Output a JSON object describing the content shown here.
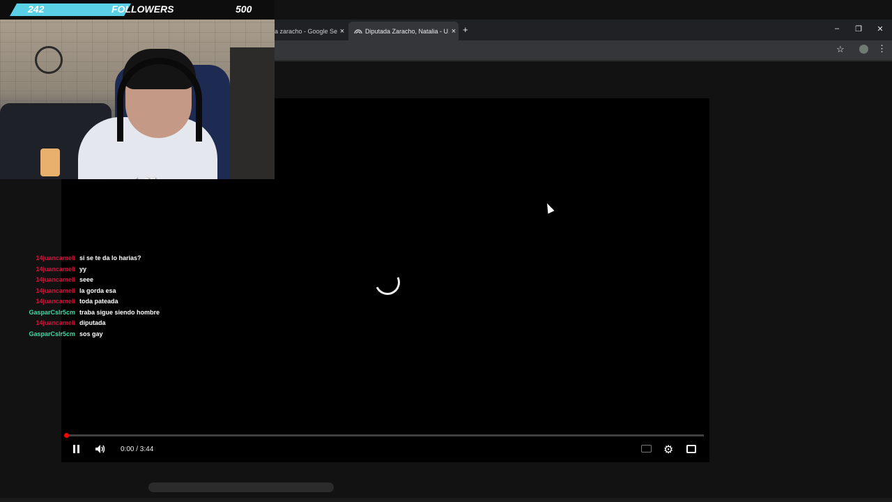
{
  "goal": {
    "current": "242",
    "label": "FOLLOWERS",
    "target": "500",
    "progress_fraction": 0.484,
    "fill_color": "#5ad0e6"
  },
  "browser": {
    "tabs": [
      {
        "title": "a zaracho - Google Sea",
        "active": false,
        "close": "×"
      },
      {
        "title": "Diputada Zaracho, Natalia - U...",
        "active": true,
        "close": "×"
      }
    ],
    "new_tab": "+",
    "window_controls": {
      "minimize": "–",
      "maximize": "❐",
      "close": "✕"
    },
    "toolbar": {
      "bookmark_icon": "star-icon",
      "menu_icon": "kebab-menu-icon"
    }
  },
  "webcam": {
    "overlay_name": "sampie05"
  },
  "player": {
    "time": "0:00 / 3:44",
    "progress_fraction": 0.0,
    "state": "loading",
    "controls": [
      "pause-icon",
      "volume-icon",
      "captions-icon",
      "gear-icon",
      "theater-icon"
    ],
    "accent_color": "#ff0000"
  },
  "chat": {
    "messages": [
      {
        "user": "14juancameli",
        "text": "si se te da lo harias?",
        "color": "#d1143b"
      },
      {
        "user": "14juancameli",
        "text": "yy",
        "color": "#d1143b"
      },
      {
        "user": "14juancameli",
        "text": "seee",
        "color": "#d1143b"
      },
      {
        "user": "14juancameli",
        "text": "la gorda esa",
        "color": "#d1143b"
      },
      {
        "user": "14juancameli",
        "text": "toda pateada",
        "color": "#d1143b"
      },
      {
        "user": "GasparCslr5cm",
        "text": "traba sigue siendo hombre",
        "color": "#3fd9a6"
      },
      {
        "user": "14juancameli",
        "text": "diputada",
        "color": "#d1143b"
      },
      {
        "user": "GasparCslr5cm",
        "text": "sos gay",
        "color": "#3fd9a6"
      }
    ]
  }
}
